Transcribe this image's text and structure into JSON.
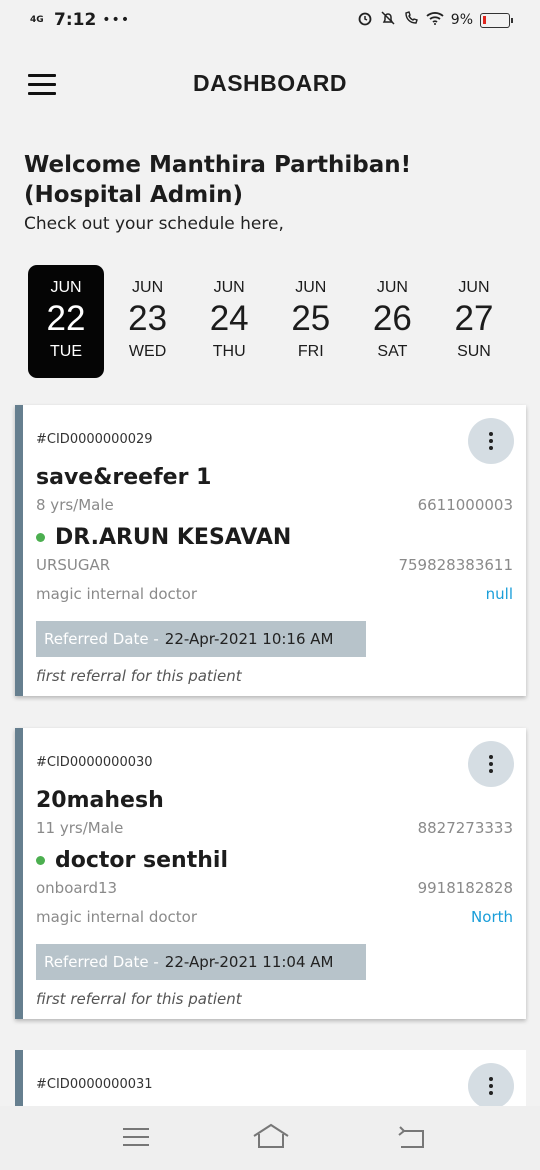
{
  "status_bar": {
    "network": "4G",
    "time": "7:12",
    "overflow": "•••",
    "battery_percent": "9%",
    "icons": [
      "alarm-icon",
      "mute-icon",
      "wifi-call-icon",
      "wifi-icon",
      "battery-icon"
    ]
  },
  "header": {
    "title": "DASHBOARD",
    "menu_icon": "hamburger-icon"
  },
  "welcome": {
    "title": "Welcome Manthira Parthiban! (Hospital Admin)",
    "subtitle": "Check out your schedule here,"
  },
  "dates": [
    {
      "month": "JUN",
      "day": "22",
      "weekday": "TUE",
      "selected": true
    },
    {
      "month": "JUN",
      "day": "23",
      "weekday": "WED",
      "selected": false
    },
    {
      "month": "JUN",
      "day": "24",
      "weekday": "THU",
      "selected": false
    },
    {
      "month": "JUN",
      "day": "25",
      "weekday": "FRI",
      "selected": false
    },
    {
      "month": "JUN",
      "day": "26",
      "weekday": "SAT",
      "selected": false
    },
    {
      "month": "JUN",
      "day": "27",
      "weekday": "SUN",
      "selected": false
    }
  ],
  "referrals": [
    {
      "cid": "#CID0000000029",
      "patient_name": "save&reefer 1",
      "age_gender": "8 yrs/Male",
      "patient_phone": "6611000003",
      "doctor_name": "DR.ARUN KESAVAN",
      "hospital": "URSUGAR",
      "doctor_phone": "759828383611",
      "doctor_type": "magic internal doctor",
      "location": "null",
      "referred_label": "Referred Date -",
      "referred_date": "22-Apr-2021 10:16 AM",
      "note": "first referral for this patient"
    },
    {
      "cid": "#CID0000000030",
      "patient_name": "20mahesh",
      "age_gender": "11 yrs/Male",
      "patient_phone": "8827273333",
      "doctor_name": "doctor senthil",
      "hospital": "onboard13",
      "doctor_phone": "9918182828",
      "doctor_type": "magic internal doctor",
      "location": "North",
      "referred_label": "Referred Date -",
      "referred_date": "22-Apr-2021 11:04 AM",
      "note": "first referral for this patient"
    },
    {
      "cid": "#CID0000000031"
    }
  ],
  "colors": {
    "card_accent": "#667f8f",
    "link_blue": "#1a9ed9",
    "status_green": "#4caf50",
    "selected_date_bg": "#050505"
  },
  "bottom_nav": {
    "icons": [
      "menu-icon",
      "home-icon",
      "back-icon"
    ]
  }
}
